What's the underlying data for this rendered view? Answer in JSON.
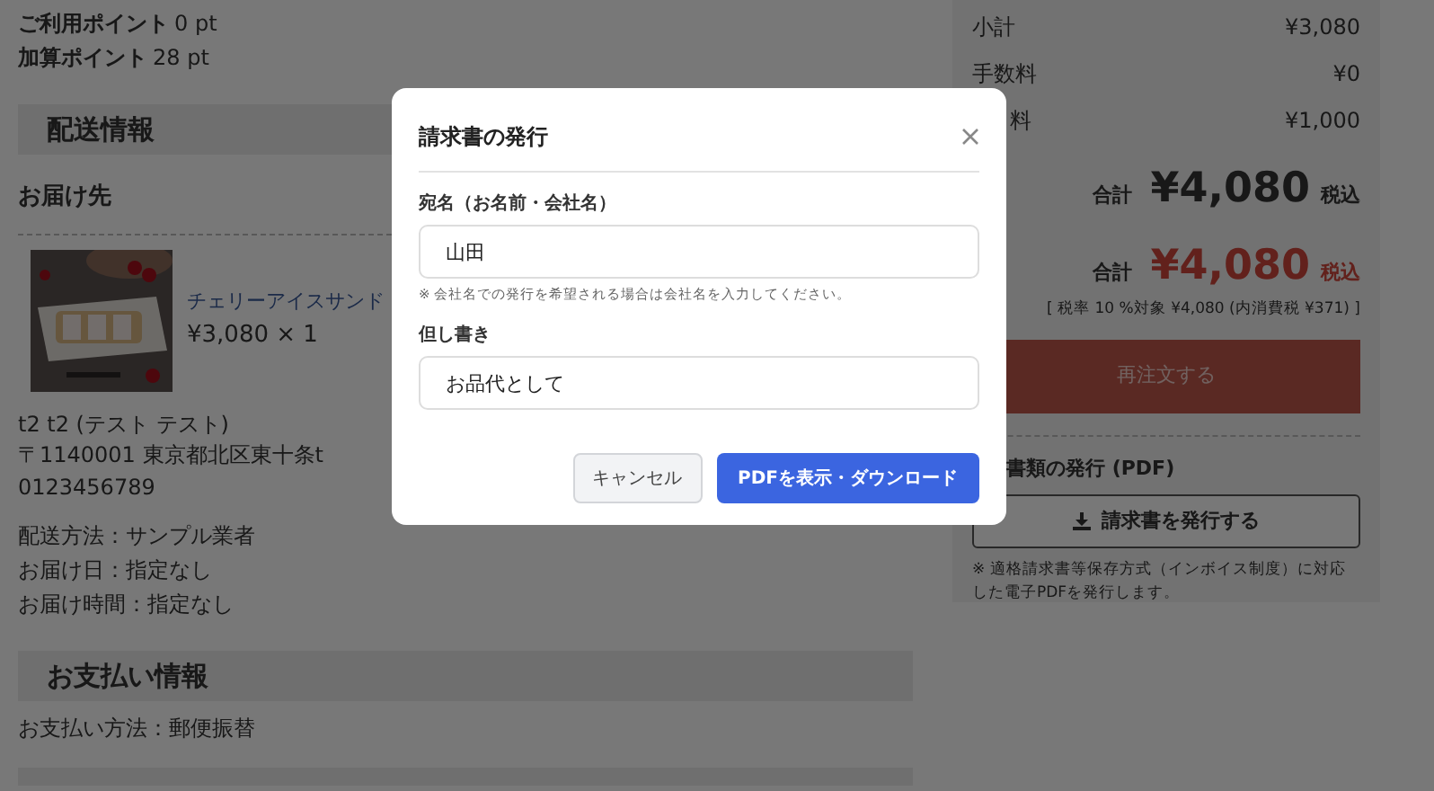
{
  "points": [
    {
      "label": "ご利用ポイント",
      "value": "0 pt"
    },
    {
      "label": "加算ポイント",
      "value": "28 pt"
    }
  ],
  "shipping": {
    "heading": "配送情報",
    "subheading": "お届け先",
    "product": {
      "kind": "picture",
      "name": "チェリーアイスサンド",
      "price": "¥3,080 × 1"
    },
    "address_lines": [
      "t2 t2 (テスト テスト)",
      "〒1140001 東京都北区東十条t",
      "0123456789"
    ],
    "details": [
      "配送方法：サンプル業者",
      "お届け日：指定なし",
      "お届け時間：指定なし"
    ]
  },
  "payment": {
    "heading": "お支払い情報",
    "lines": [
      "お支払い方法：郵便振替"
    ]
  },
  "summary": {
    "rows": [
      {
        "label": "小計",
        "value": "¥3,080",
        "kind": "full"
      },
      {
        "label": "手数料",
        "value": "¥0",
        "kind": "full"
      },
      {
        "label": "料",
        "value": "¥1,000",
        "kind": "cut"
      }
    ],
    "totals": [
      {
        "label": "合計",
        "amount": "¥4,080",
        "suffix": "税込",
        "kind": "plain"
      },
      {
        "label": "合計",
        "amount": "¥4,080",
        "suffix": "税込",
        "kind": "highlight"
      }
    ],
    "tax_note": "[ 税率 10 %対象 ¥4,080 (内消費税 ¥371) ]",
    "reorder_button": "再注文する",
    "documents": {
      "heading": "書類の発行 (PDF)",
      "button": "請求書を発行する",
      "note": "※ 適格請求書等保存方式（インボイス制度）に対応した電子PDFを発行します。"
    }
  },
  "modal": {
    "title": "請求書の発行",
    "fields": [
      {
        "label": "宛名（お名前・会社名）",
        "value": "山田",
        "help": "※ 会社名での発行を希望される場合は会社名を入力してください。"
      },
      {
        "label": "但し書き",
        "value": "お品代として"
      }
    ],
    "buttons": [
      {
        "label": "キャンセル",
        "kind": "secondary"
      },
      {
        "label": "PDFを表示・ダウンロード",
        "kind": "primary"
      }
    ]
  }
}
